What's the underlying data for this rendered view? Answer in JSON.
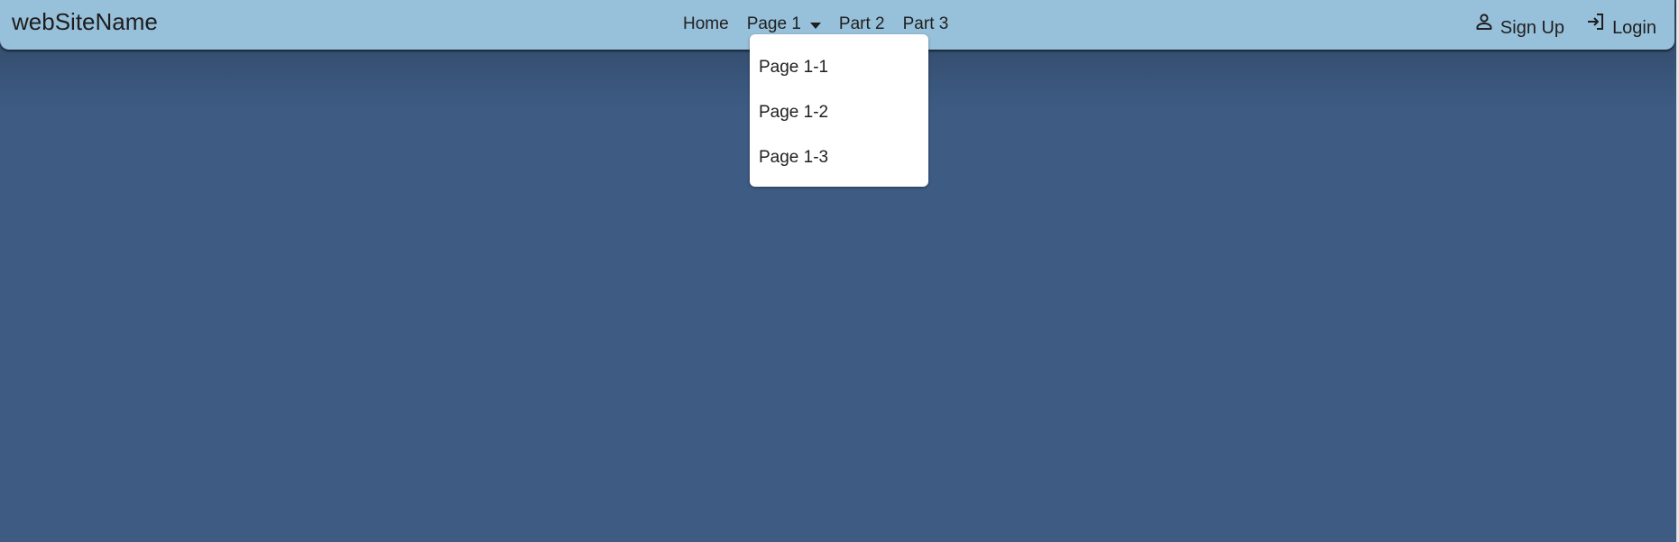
{
  "brand": "webSiteName",
  "nav": {
    "home": "Home",
    "page1": "Page 1",
    "part2": "Part 2",
    "part3": "Part 3"
  },
  "actions": {
    "signup": "Sign Up",
    "login": "Login"
  },
  "dropdown": {
    "items": [
      "Page 1-1",
      "Page 1-2",
      "Page 1-3"
    ]
  },
  "icons": {
    "signup": "person-icon",
    "login": "login-icon"
  },
  "colors": {
    "navbar": "#97c0da",
    "page_background": "#3d5b83",
    "dropdown_background": "#ffffff"
  }
}
